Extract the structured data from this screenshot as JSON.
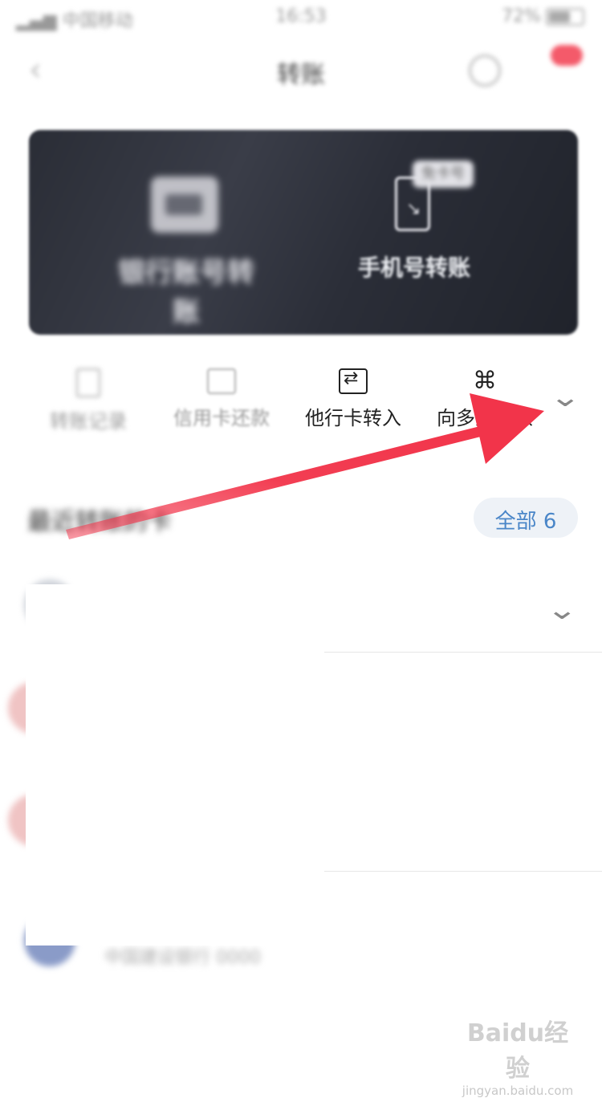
{
  "status_bar": {
    "carrier": "中国移动",
    "time": "16:53",
    "battery": "72%"
  },
  "nav": {
    "title": "转账"
  },
  "banner": {
    "left_tile": "银行账号转账",
    "right_tile": "手机号转账",
    "right_tag": "免卡号"
  },
  "quick_actions": {
    "items": [
      {
        "label": "转账记录"
      },
      {
        "label": "信用卡还款"
      },
      {
        "label": "他行卡转入"
      },
      {
        "label": "向多人转账"
      }
    ]
  },
  "recent": {
    "title": "最近转账的卡",
    "all_button": "全部 6",
    "last_account_text": "中国建设银行 0000"
  },
  "watermark": {
    "logo": "Baidu经验",
    "url": "jingyan.baidu.com"
  },
  "colors": {
    "annotation_arrow": "#f2344a",
    "link_blue": "#4a86c8",
    "badge_red": "#f45a6a"
  }
}
